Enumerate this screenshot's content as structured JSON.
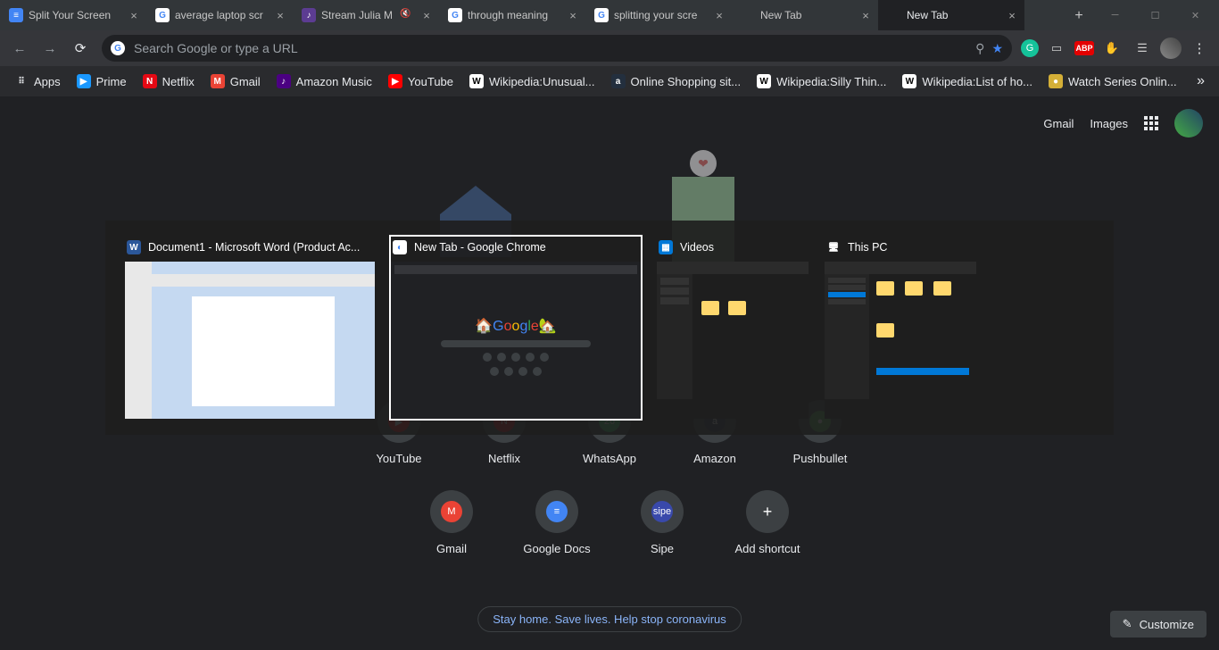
{
  "tabs": [
    {
      "title": "Split Your Screen",
      "favcolor": "#4285f4"
    },
    {
      "title": "average laptop scr",
      "favcolor": "#fff"
    },
    {
      "title": "Stream Julia M",
      "favcolor": "#5c3c92",
      "audio": true
    },
    {
      "title": "through meaning",
      "favcolor": "#fff"
    },
    {
      "title": "splitting your scre",
      "favcolor": "#fff"
    },
    {
      "title": "New Tab",
      "favcolor": "transparent"
    },
    {
      "title": "New Tab",
      "favcolor": "transparent",
      "active": true
    }
  ],
  "omnibox": {
    "placeholder": "Search Google or type a URL"
  },
  "bookmarks": [
    {
      "label": "Apps",
      "icon": "⠿",
      "color": "transparent"
    },
    {
      "label": "Prime",
      "icon": "▶",
      "color": "#1a98ff"
    },
    {
      "label": "Netflix",
      "icon": "N",
      "color": "#e50914"
    },
    {
      "label": "Gmail",
      "icon": "M",
      "color": "#ea4335"
    },
    {
      "label": "Amazon Music",
      "icon": "♪",
      "color": "#4b0082"
    },
    {
      "label": "YouTube",
      "icon": "▶",
      "color": "#ff0000"
    },
    {
      "label": "Wikipedia:Unusual...",
      "icon": "W",
      "color": "#fff"
    },
    {
      "label": "Online Shopping sit...",
      "icon": "a",
      "color": "#232f3e"
    },
    {
      "label": "Wikipedia:Silly Thin...",
      "icon": "W",
      "color": "#fff"
    },
    {
      "label": "Wikipedia:List of ho...",
      "icon": "W",
      "color": "#fff"
    },
    {
      "label": "Watch Series Onlin...",
      "icon": "●",
      "color": "#d4af37"
    }
  ],
  "header": {
    "gmail": "Gmail",
    "images": "Images"
  },
  "shortcuts_row1": [
    {
      "label": "YouTube",
      "glyph": "▶",
      "color": "#ff0000"
    },
    {
      "label": "Netflix",
      "glyph": "N",
      "color": "#e50914"
    },
    {
      "label": "WhatsApp",
      "glyph": "26",
      "color": "#25d366"
    },
    {
      "label": "Amazon",
      "glyph": "a",
      "color": "#232f3e"
    },
    {
      "label": "Pushbullet",
      "glyph": "●",
      "color": "#4caf50"
    }
  ],
  "shortcuts_row2": [
    {
      "label": "Gmail",
      "glyph": "M",
      "color": "#ea4335"
    },
    {
      "label": "Google Docs",
      "glyph": "≡",
      "color": "#4285f4"
    },
    {
      "label": "Sipe",
      "glyph": "sipe",
      "color": "#3949ab"
    },
    {
      "label": "Add shortcut",
      "glyph": "+",
      "color": "#3c4043"
    }
  ],
  "banner": "Stay home. Save lives. Help stop coronavirus",
  "customize": "Customize",
  "alttab": [
    {
      "title": "Document1 - Microsoft Word (Product Ac...",
      "icon": "W",
      "iconbg": "#2b579a"
    },
    {
      "title": "New Tab - Google Chrome",
      "icon": "◐",
      "iconbg": "#fff",
      "selected": true
    },
    {
      "title": "Videos",
      "icon": "▦",
      "iconbg": "#0078d7"
    },
    {
      "title": "This PC",
      "icon": "🖥",
      "iconbg": "transparent"
    }
  ]
}
